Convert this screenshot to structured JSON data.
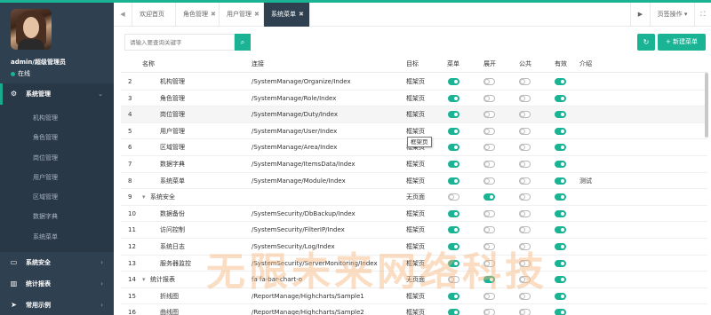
{
  "sidebar": {
    "user_name": "admin/超级管理员",
    "user_status": "在线",
    "groups": [
      {
        "label": "系统管理",
        "icon": "gears-icon",
        "active": true,
        "arrow": "⌄"
      },
      {
        "label": "系统安全",
        "icon": "desktop-icon",
        "active": false,
        "arrow": "›"
      },
      {
        "label": "统计报表",
        "icon": "bar-chart-icon",
        "active": false,
        "arrow": "›"
      },
      {
        "label": "常用示例",
        "icon": "paper-plane-icon",
        "active": false,
        "arrow": "›"
      }
    ],
    "submenu": [
      "机构管理",
      "角色管理",
      "岗位管理",
      "用户管理",
      "区域管理",
      "数据字典",
      "系统菜单"
    ]
  },
  "tabbar": {
    "prev_glyph": "◀",
    "next_glyph": "▶",
    "tabs": [
      {
        "label": "欢迎首页",
        "closable": false,
        "active": false
      },
      {
        "label": "角色管理",
        "closable": true,
        "active": false
      },
      {
        "label": "用户管理",
        "closable": true,
        "active": false
      },
      {
        "label": "系统菜单",
        "closable": true,
        "active": true
      }
    ],
    "page_ops": "页签操作",
    "page_ops_caret": "▾",
    "fullscreen_glyph": "⛶",
    "close_glyph": "✖"
  },
  "toolbar": {
    "search_placeholder": "请输入要查询关键字",
    "search_glyph": "⌕",
    "refresh_glyph": "↻",
    "add_label": "+ 新建菜单"
  },
  "grid": {
    "columns": [
      "名称",
      "连接",
      "目标",
      "菜单",
      "展开",
      "公共",
      "有效",
      "介绍"
    ],
    "rows": [
      {
        "no": "2",
        "name": "机构管理",
        "indent": 1,
        "url": "/SystemManage/Organize/Index",
        "target": "框架页",
        "menu": true,
        "expand": false,
        "public": false,
        "valid": true,
        "desc": ""
      },
      {
        "no": "3",
        "name": "角色管理",
        "indent": 1,
        "url": "/SystemManage/Role/Index",
        "target": "框架页",
        "menu": true,
        "expand": false,
        "public": false,
        "valid": true,
        "desc": ""
      },
      {
        "no": "4",
        "name": "岗位管理",
        "indent": 1,
        "url": "/SystemManage/Duty/Index",
        "target": "框架页",
        "menu": true,
        "expand": false,
        "public": false,
        "valid": true,
        "desc": "",
        "highlight": true
      },
      {
        "no": "5",
        "name": "用户管理",
        "indent": 1,
        "url": "/SystemManage/User/Index",
        "target": "框架页",
        "menu": true,
        "expand": false,
        "public": false,
        "valid": true,
        "desc": ""
      },
      {
        "no": "6",
        "name": "区域管理",
        "indent": 1,
        "url": "/SystemManage/Area/Index",
        "target": "框架页",
        "menu": true,
        "expand": false,
        "public": false,
        "valid": true,
        "desc": ""
      },
      {
        "no": "7",
        "name": "数据字典",
        "indent": 1,
        "url": "/SystemManage/ItemsData/Index",
        "target": "框架页",
        "menu": true,
        "expand": false,
        "public": false,
        "valid": true,
        "desc": ""
      },
      {
        "no": "8",
        "name": "系统菜单",
        "indent": 1,
        "url": "/SystemManage/Module/Index",
        "target": "框架页",
        "menu": true,
        "expand": false,
        "public": false,
        "valid": true,
        "desc": "测试"
      },
      {
        "no": "9",
        "name": "系统安全",
        "indent": 0,
        "caret": "▾",
        "url": "",
        "target": "无页面",
        "menu": false,
        "expand": true,
        "public": false,
        "valid": true,
        "desc": ""
      },
      {
        "no": "10",
        "name": "数据备份",
        "indent": 1,
        "url": "/SystemSecurity/DbBackup/Index",
        "target": "框架页",
        "menu": true,
        "expand": false,
        "public": false,
        "valid": true,
        "desc": ""
      },
      {
        "no": "11",
        "name": "访问控制",
        "indent": 1,
        "url": "/SystemSecurity/FilterIP/Index",
        "target": "框架页",
        "menu": true,
        "expand": false,
        "public": false,
        "valid": true,
        "desc": ""
      },
      {
        "no": "12",
        "name": "系统日志",
        "indent": 1,
        "url": "/SystemSecurity/Log/Index",
        "target": "框架页",
        "menu": true,
        "expand": false,
        "public": false,
        "valid": true,
        "desc": ""
      },
      {
        "no": "13",
        "name": "服务器监控",
        "indent": 1,
        "url": "/SystemSecurity/ServerMonitoring/Index",
        "target": "框架页",
        "menu": true,
        "expand": false,
        "public": false,
        "valid": true,
        "desc": ""
      },
      {
        "no": "14",
        "name": "统计报表",
        "indent": 0,
        "caret": "▾",
        "url": "fa fa-bar-chart-o",
        "target": "无页面",
        "menu": false,
        "expand": true,
        "public": false,
        "valid": true,
        "desc": ""
      },
      {
        "no": "15",
        "name": "折线图",
        "indent": 1,
        "url": "/ReportManage/Highcharts/Sample1",
        "target": "框架页",
        "menu": true,
        "expand": false,
        "public": false,
        "valid": true,
        "desc": ""
      },
      {
        "no": "16",
        "name": "曲线图",
        "indent": 1,
        "url": "/ReportManage/Highcharts/Sample2",
        "target": "框架页",
        "menu": true,
        "expand": false,
        "public": false,
        "valid": true,
        "desc": ""
      }
    ],
    "tooltip": "框架页"
  },
  "watermark": "无限未来网络科技",
  "colors": {
    "accent": "#1ab394",
    "sidebar": "#2f4050",
    "sidebar_active": "#293846"
  }
}
